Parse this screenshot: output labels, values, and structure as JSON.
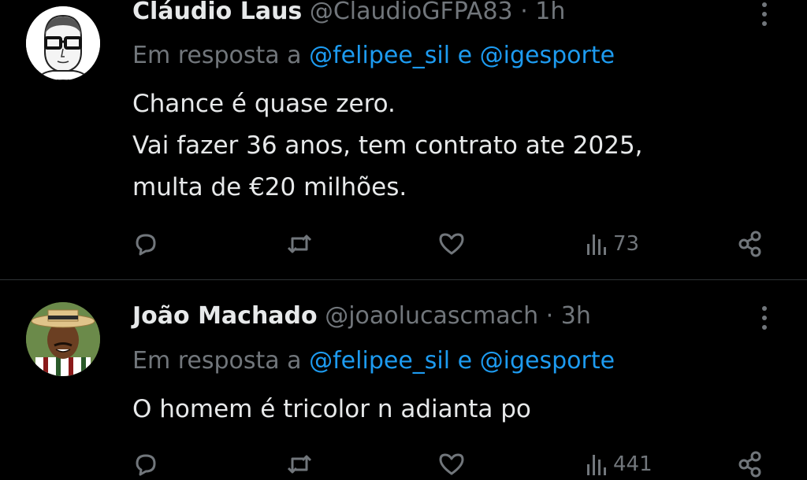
{
  "tweets": [
    {
      "name": "Cláudio Laus",
      "handle": "@ClaudioGFPA83",
      "separator": "·",
      "time": "1h",
      "reply_prefix": "Em resposta a",
      "mention1": "@felipee_sil",
      "conj": "e",
      "mention2": "@igesporte",
      "lines": [
        "Chance é quase zero.",
        "Vai fazer 36 anos, tem contrato ate 2025,",
        "multa de €20 milhões."
      ],
      "views": "73"
    },
    {
      "name": "João Machado",
      "handle": "@joaolucascmach",
      "separator": "·",
      "time": "3h",
      "reply_prefix": "Em resposta a",
      "mention1": "@felipee_sil",
      "conj": "e",
      "mention2": "@igesporte",
      "lines": [
        "O homem é tricolor n adianta po"
      ],
      "views": "441"
    }
  ],
  "icons": {
    "reply": "reply-icon",
    "retweet": "retweet-icon",
    "like": "like-icon",
    "views": "views-icon",
    "share": "share-icon",
    "more": "more-icon"
  },
  "colors": {
    "background": "#000000",
    "text": "#e7e9ea",
    "muted": "#71767b",
    "mention": "#1d9bf0",
    "divider": "#2f3336"
  }
}
